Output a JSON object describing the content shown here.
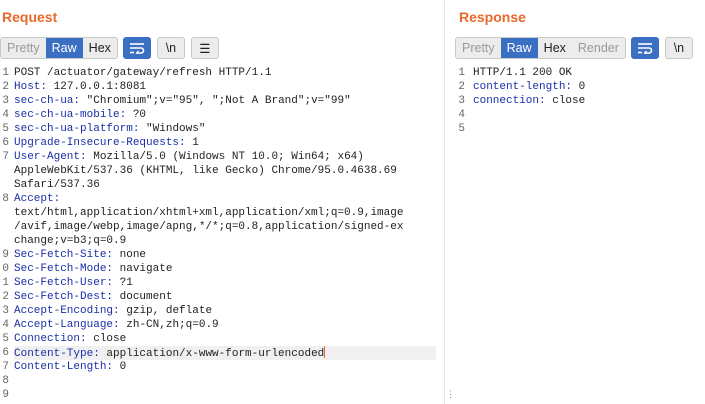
{
  "request": {
    "title": "Request",
    "tabs": [
      "Pretty",
      "Raw",
      "Hex"
    ],
    "active_tab": "Raw",
    "wrap_icon_label": "",
    "newline_label": "\\n",
    "menu_icon_label": "☰",
    "line_numbers": [
      "1",
      "2",
      "3",
      "4",
      "5",
      "6",
      "7",
      "",
      "",
      "8",
      "",
      "",
      "",
      "9",
      "0",
      "1",
      "2",
      "3",
      "4",
      "5",
      "6",
      "7",
      "8",
      "9"
    ],
    "lines": [
      {
        "plain": "POST /actuator/gateway/refresh HTTP/1.1"
      },
      {
        "name": "Host",
        "value": " 127.0.0.1:8081"
      },
      {
        "name": "sec-ch-ua",
        "value": " \"Chromium\";v=\"95\", \";Not A Brand\";v=\"99\""
      },
      {
        "name": "sec-ch-ua-mobile",
        "value": " ?0"
      },
      {
        "name": "sec-ch-ua-platform",
        "value": " \"Windows\""
      },
      {
        "name": "Upgrade-Insecure-Requests",
        "value": " 1"
      },
      {
        "name": "User-Agent",
        "value": " Mozilla/5.0 (Windows NT 10.0; Win64; x64)"
      },
      {
        "plain": "AppleWebKit/537.36 (KHTML, like Gecko) Chrome/95.0.4638.69"
      },
      {
        "plain": "Safari/537.36"
      },
      {
        "name": "Accept",
        "value": ""
      },
      {
        "plain": "text/html,application/xhtml+xml,application/xml;q=0.9,image"
      },
      {
        "plain": "/avif,image/webp,image/apng,*/*;q=0.8,application/signed-ex"
      },
      {
        "plain": "change;v=b3;q=0.9"
      },
      {
        "name": "Sec-Fetch-Site",
        "value": " none"
      },
      {
        "name": "Sec-Fetch-Mode",
        "value": " navigate"
      },
      {
        "name": "Sec-Fetch-User",
        "value": " ?1"
      },
      {
        "name": "Sec-Fetch-Dest",
        "value": " document"
      },
      {
        "name": "Accept-Encoding",
        "value": " gzip, deflate"
      },
      {
        "name": "Accept-Language",
        "value": " zh-CN,zh;q=0.9"
      },
      {
        "name": "Connection",
        "value": " close"
      },
      {
        "name": "Content-Type",
        "value": " application/x-www-form-urlencoded",
        "current": true
      },
      {
        "name": "Content-Length",
        "value": " 0"
      },
      {
        "plain": ""
      },
      {
        "plain": ""
      }
    ]
  },
  "response": {
    "title": "Response",
    "tabs": [
      "Pretty",
      "Raw",
      "Hex",
      "Render"
    ],
    "active_tab": "Raw",
    "newline_label": "\\n",
    "line_numbers": [
      "1",
      "2",
      "3",
      "4",
      "5"
    ],
    "lines": [
      {
        "plain": "HTTP/1.1 200 OK"
      },
      {
        "name": "content-length",
        "value": " 0"
      },
      {
        "name": "connection",
        "value": " close"
      },
      {
        "plain": ""
      },
      {
        "plain": ""
      }
    ]
  },
  "colors": {
    "accent": "#e8692b",
    "active_tab": "#3b6fc4",
    "header_name": "#1a2fa8"
  }
}
